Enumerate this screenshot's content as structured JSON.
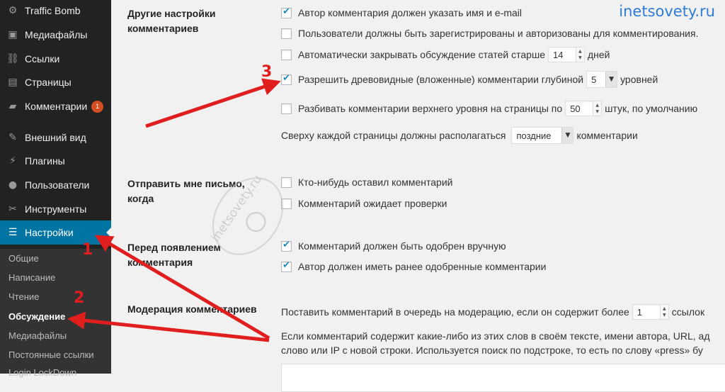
{
  "sidebar": {
    "items": [
      {
        "label": "Traffic Bomb",
        "icon": "gear-icon"
      },
      {
        "label": "Медиафайлы",
        "icon": "media-icon"
      },
      {
        "label": "Ссылки",
        "icon": "link-icon"
      },
      {
        "label": "Страницы",
        "icon": "page-icon"
      },
      {
        "label": "Комментарии",
        "icon": "comment-icon",
        "badge": "1"
      },
      {
        "label": "Внешний вид",
        "icon": "brush-icon"
      },
      {
        "label": "Плагины",
        "icon": "plugin-icon"
      },
      {
        "label": "Пользователи",
        "icon": "user-icon"
      },
      {
        "label": "Инструменты",
        "icon": "wrench-icon"
      },
      {
        "label": "Настройки",
        "icon": "settings-icon",
        "active": true
      }
    ],
    "submenu": [
      "Общие",
      "Написание",
      "Чтение",
      "Обсуждение",
      "Медиафайлы",
      "Постоянные ссылки",
      "Login LockDown"
    ]
  },
  "sections": {
    "other": {
      "label": "Другие настройки комментариев",
      "require_name_email": "Автор комментария должен указать имя и e-mail",
      "registered_only": "Пользователи должны быть зарегистрированы и авторизованы для комментирования.",
      "auto_close_prefix": "Автоматически закрывать обсуждение статей старше",
      "auto_close_days": "14",
      "auto_close_suffix": "дней",
      "threaded_prefix": "Разрешить древовидные (вложенные) комментарии глубиной",
      "threaded_depth": "5",
      "threaded_suffix": "уровней",
      "paginate_prefix": "Разбивать комментарии верхнего уровня на страницы по",
      "paginate_count": "50",
      "paginate_suffix": "штук, по умолчанию",
      "order_prefix": "Сверху каждой страницы должны располагаться",
      "order_value": "поздние",
      "order_suffix": "комментарии"
    },
    "email": {
      "label": "Отправить мне письмо, когда",
      "anyone_posts": "Кто-нибудь оставил комментарий",
      "moderation": "Комментарий ожидает проверки"
    },
    "before": {
      "label": "Перед появлением комментария",
      "manual_approve": "Комментарий должен быть одобрен вручную",
      "previously_approved": "Автор должен иметь ранее одобренные комментарии"
    },
    "moderation": {
      "label": "Модерация комментариев",
      "links_prefix": "Поставить комментарий в очередь на модерацию, если он содержит более",
      "links_count": "1",
      "links_suffix": "ссылок",
      "words_line1": "Если комментарий содержит какие-либо из этих слов в своём тексте, имени автора, URL, ад",
      "words_line2": "слово или IP с новой строки. Используется поиск по подстроке, то есть по слову «press» бу"
    }
  },
  "watermark": "inetsovety.ru",
  "stamp_text": "inetsovety.ru",
  "annotations": [
    "1",
    "2",
    "3"
  ],
  "colors": {
    "accent": "#0074a2",
    "arrow": "#e01e1e",
    "checkmark": "#1e8cbe",
    "watermark": "#2e7cd4"
  }
}
